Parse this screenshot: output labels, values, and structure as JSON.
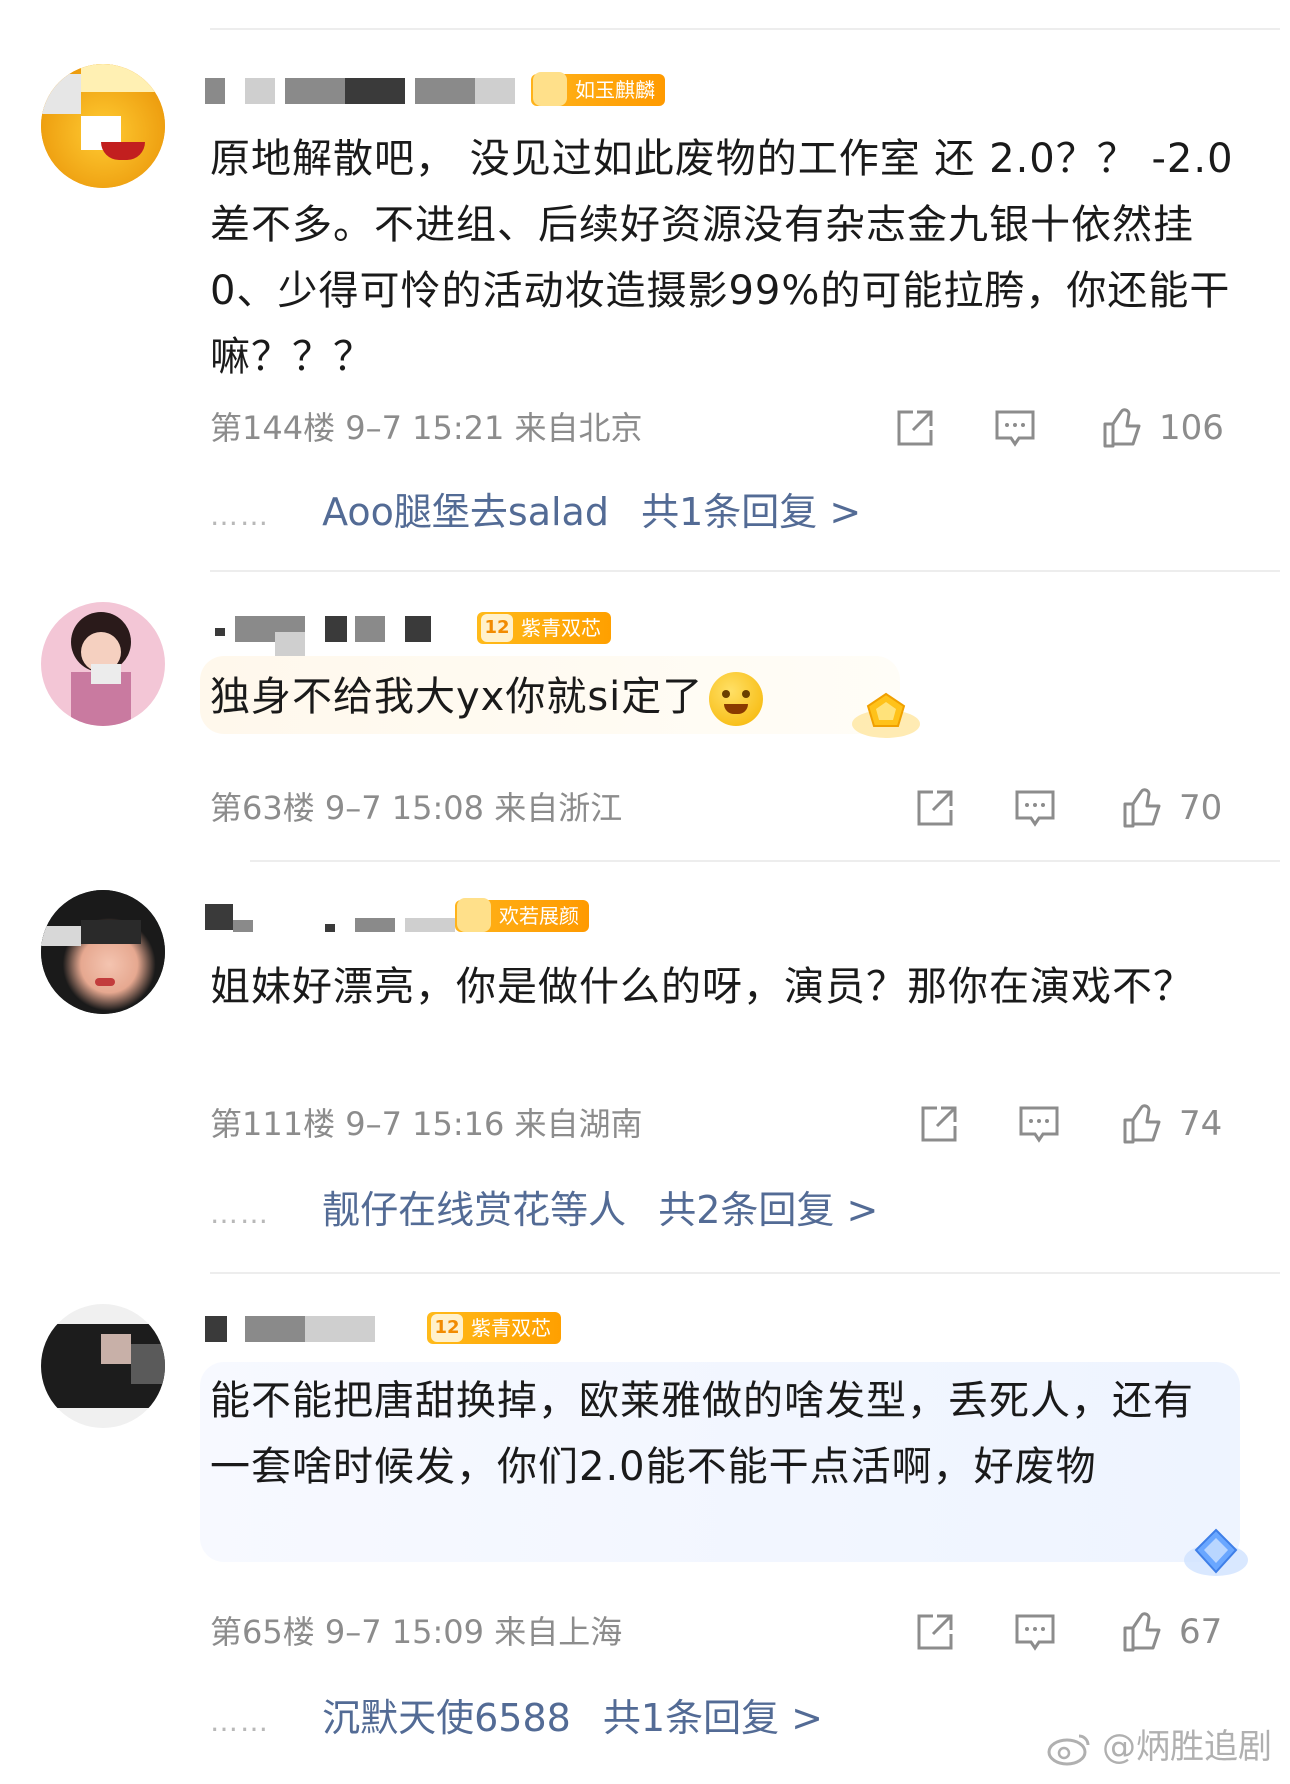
{
  "comments": [
    {
      "badge_label": "如玉麒麟",
      "badge_level": "",
      "text": "原地解散吧， 没见过如此废物的工作室 还 2.0？？ -2.0差不多。不进组、后续好资源没有杂志金九银十依然挂0、少得可怜的活动妆造摄影99%的可能拉胯，你还能干嘛？？？",
      "floor": "第144楼",
      "time": "9–7 15:21",
      "location": "来自北京",
      "likes": "106",
      "reply_user": "Aoo腿堡去salad",
      "reply_count": "共1条回复 >"
    },
    {
      "badge_label": "紫青双芯",
      "badge_level": "12",
      "text": "独身不给我大yx你就si定了",
      "floor": "第63楼",
      "time": "9–7 15:08",
      "location": "来自浙江",
      "likes": "70"
    },
    {
      "badge_label": "欢若展颜",
      "badge_level": "",
      "text": "姐妹好漂亮，你是做什么的呀，演员？那你在演戏不？",
      "floor": "第111楼",
      "time": "9–7 15:16",
      "location": "来自湖南",
      "likes": "74",
      "reply_user": "靓仔在线赏花等人",
      "reply_count": "共2条回复 >"
    },
    {
      "badge_label": "紫青双芯",
      "badge_level": "12",
      "text": "能不能把唐甜换掉，欧莱雅做的啥发型，丢死人，还有一套啥时候发，你们2.0能不能干点活啊，好废物",
      "floor": "第65楼",
      "time": "9–7 15:09",
      "location": "来自上海",
      "likes": "67",
      "reply_user": "沉默天使6588",
      "reply_count": "共1条回复 >"
    }
  ],
  "reply_dots": "……",
  "watermark": "@炳胜追剧",
  "colors": {
    "link": "#536b95",
    "meta": "#8c8c8c",
    "badge": "#ff9a00"
  },
  "icons": [
    "share-icon",
    "comment-icon",
    "like-icon"
  ]
}
